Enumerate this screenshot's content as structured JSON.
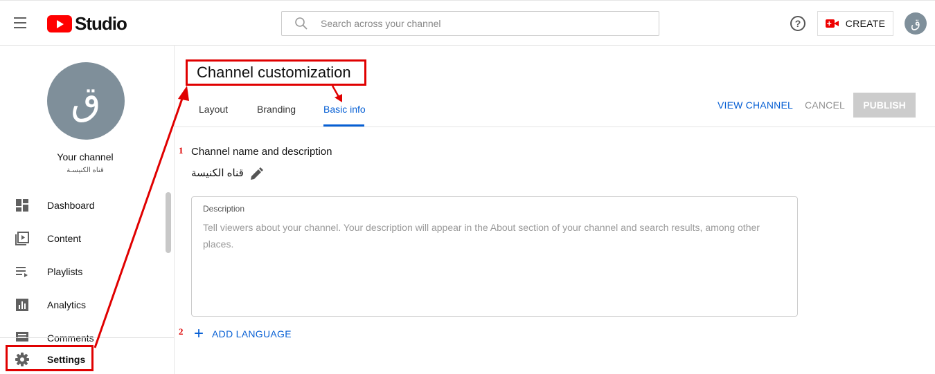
{
  "header": {
    "logo_text": "Studio",
    "search_placeholder": "Search across your channel",
    "help_symbol": "?",
    "create_label": "CREATE",
    "avatar_letter": "ق"
  },
  "sidebar": {
    "avatar_letter": "ق",
    "channel_heading": "Your channel",
    "channel_name": "قناه الكنيسـة",
    "items": [
      {
        "label": "Dashboard",
        "icon": "dashboard-icon"
      },
      {
        "label": "Content",
        "icon": "content-icon"
      },
      {
        "label": "Playlists",
        "icon": "playlists-icon"
      },
      {
        "label": "Analytics",
        "icon": "analytics-icon"
      },
      {
        "label": "Comments",
        "icon": "comments-icon"
      }
    ],
    "settings_label": "Settings"
  },
  "main": {
    "title": "Channel customization",
    "tabs": [
      {
        "label": "Layout"
      },
      {
        "label": "Branding"
      },
      {
        "label": "Basic info"
      }
    ],
    "active_tab": "Basic info",
    "actions": {
      "view_channel": "VIEW CHANNEL",
      "cancel": "CANCEL",
      "publish": "PUBLISH"
    },
    "section_title": "Channel name and description",
    "channel_name": "قناه الكنيسة",
    "description": {
      "label": "Description",
      "placeholder": "Tell viewers about your channel. Your description will appear in the About section of your channel and search results, among other places."
    },
    "add_language": "ADD LANGUAGE"
  },
  "annotations": {
    "step1": "1",
    "step2": "2"
  },
  "colors": {
    "accent_blue": "#065fd4",
    "annotation_red": "#e00000",
    "youtube_red": "#ff0000",
    "avatar_gray": "#7f8f9a"
  }
}
